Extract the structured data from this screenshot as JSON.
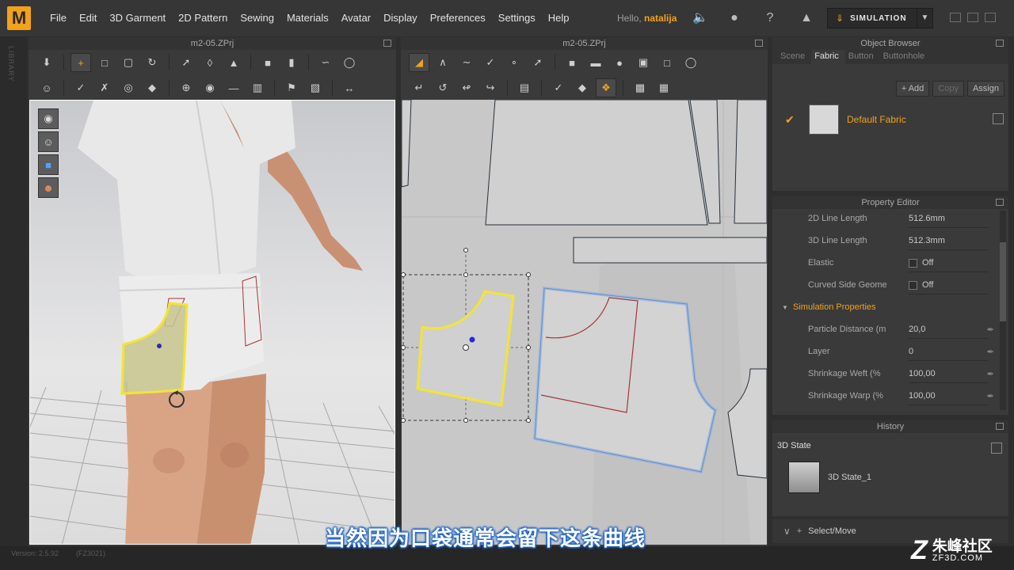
{
  "menu": [
    "File",
    "Edit",
    "3D Garment",
    "2D Pattern",
    "Sewing",
    "Materials",
    "Avatar",
    "Display",
    "Preferences",
    "Settings",
    "Help"
  ],
  "user": {
    "hello": "Hello,",
    "name": "natalija"
  },
  "simulation": {
    "label": "SIMULATION"
  },
  "left_strip": "LIBRARY",
  "view3d": {
    "title": "m2-05.ZPrj"
  },
  "view2d": {
    "title": "m2-05.ZPrj"
  },
  "object_browser": {
    "title": "Object Browser",
    "tabs": [
      "Scene",
      "Fabric",
      "Button",
      "Buttonhole"
    ],
    "active_tab": "Fabric",
    "actions": {
      "add": "+ Add",
      "copy": "Copy",
      "assign": "Assign"
    },
    "fabric": {
      "name": "Default Fabric",
      "color": "#d8d8d8"
    }
  },
  "property_editor": {
    "title": "Property Editor",
    "rows": [
      {
        "name": "2D Line Length",
        "value": "512.6mm"
      },
      {
        "name": "3D Line Length",
        "value": "512.3mm"
      },
      {
        "name": "Elastic",
        "value": "Off"
      },
      {
        "name": "Curved Side Geome",
        "value": "Off"
      }
    ],
    "group": "Simulation Properties",
    "sim_rows": [
      {
        "name": "Particle Distance (m",
        "value": "20,0"
      },
      {
        "name": "Layer",
        "value": "0"
      },
      {
        "name": "Shrinkage Weft (%",
        "value": "100,00"
      },
      {
        "name": "Shrinkage Warp (%",
        "value": "100,00"
      }
    ]
  },
  "history": {
    "title": "History",
    "state": "3D State",
    "item": "3D State_1"
  },
  "select_move": "Select/Move",
  "status": {
    "version": "Version: 2.5.92",
    "build": "(FZ3021)"
  },
  "subtitle": "当然因为口袋通常会留下这条曲线",
  "watermark": {
    "cn": "朱峰社区",
    "en": "ZF3D.COM"
  },
  "colors": {
    "accent": "#f2a21b",
    "selected_outline": "#f3e531",
    "pattern_outline": "#8fb3e8",
    "pocket_line": "#a6353b"
  }
}
